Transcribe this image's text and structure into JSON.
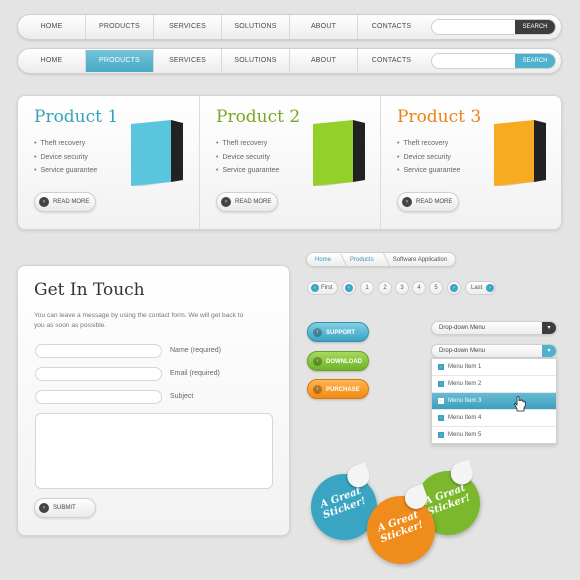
{
  "nav1": {
    "items": [
      "HOME",
      "PRODUCTS",
      "SERVICES",
      "SOLUTIONS",
      "ABOUT",
      "CONTACTS"
    ],
    "search_label": "SEARCH",
    "search_placeholder": ""
  },
  "nav2": {
    "items": [
      "HOME",
      "PRODUCTS",
      "SERVICES",
      "SOLUTIONS",
      "ABOUT",
      "CONTACTS"
    ],
    "active_index": 1,
    "search_label": "SEARCH",
    "search_placeholder": ""
  },
  "products": [
    {
      "title": "Product 1",
      "color": "#3aa0ba",
      "box_color": "#5ac6dd",
      "features": [
        "Theft recovery",
        "Device security",
        "Service guarantee"
      ],
      "button": "READ MORE"
    },
    {
      "title": "Product 2",
      "color": "#78a626",
      "box_color": "#94cf2a",
      "features": [
        "Theft recovery",
        "Device security",
        "Service guarantee"
      ],
      "button": "READ MORE"
    },
    {
      "title": "Product 3",
      "color": "#e88416",
      "box_color": "#f6ab21",
      "features": [
        "Theft recovery",
        "Device security",
        "Service guarantee"
      ],
      "button": "READ MORE"
    }
  ],
  "contact": {
    "title": "Get In Touch",
    "intro": "You can leave a message by using the contact form. We will get back to you as soon as possible.",
    "fields": [
      {
        "label": "Name (required)",
        "value": ""
      },
      {
        "label": "Email (required)",
        "value": ""
      },
      {
        "label": "Subject",
        "value": ""
      }
    ],
    "message_value": "",
    "submit_label": "SUBMIT"
  },
  "breadcrumb": [
    "Home",
    "Products",
    "Software Application"
  ],
  "pagination": {
    "first": "First",
    "pages": [
      "1",
      "2",
      "3",
      "4",
      "5"
    ],
    "last": "Last"
  },
  "action_buttons": [
    {
      "label": "SUPPORT",
      "style": "teal"
    },
    {
      "label": "DOWNLOAD",
      "style": "green"
    },
    {
      "label": "PURCHASE",
      "style": "orange"
    }
  ],
  "dropdown1": {
    "label": "Drop-down Menu"
  },
  "dropdown2": {
    "label": "Drop-down Menu",
    "items": [
      "Menu Item 1",
      "Menu Item 2",
      "Menu Item 3",
      "Menu Item 4",
      "Menu Item 5"
    ],
    "selected_index": 2
  },
  "stickers": [
    {
      "line1": "A Great",
      "line2": "Sticker!",
      "color": "#3aa4c3"
    },
    {
      "line1": "A Great",
      "line2": "Sticker!",
      "color": "#f08c1c"
    },
    {
      "line1": "A Great",
      "line2": "Sticker!",
      "color": "#7bb82c"
    }
  ]
}
